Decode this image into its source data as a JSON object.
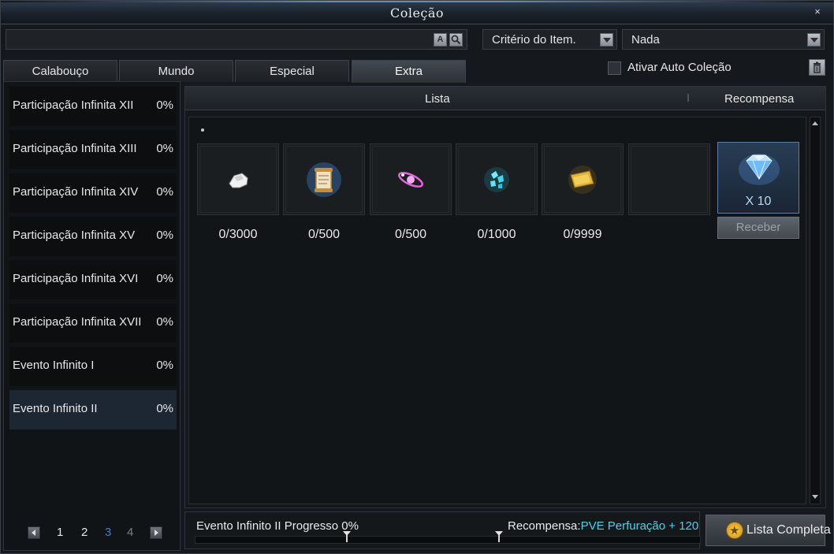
{
  "window": {
    "title": "Coleção",
    "close_symbol": "×"
  },
  "search": {
    "value": "",
    "placeholder": "",
    "btn_alpha": "A"
  },
  "filters": {
    "criteria_value": "Critério do Item.",
    "criteria2_value": "Nada"
  },
  "tabs": [
    {
      "label": "Calabouço",
      "active": false
    },
    {
      "label": "Mundo",
      "active": false
    },
    {
      "label": "Especial",
      "active": false
    },
    {
      "label": "Extra",
      "active": true
    }
  ],
  "auto_collect": {
    "label": "Ativar Auto Coleção",
    "checked": false
  },
  "categories": [
    {
      "name": "Participação Infinita XII",
      "percent": "0%"
    },
    {
      "name": "Participação Infinita XIII",
      "percent": "0%"
    },
    {
      "name": "Participação Infinita XIV",
      "percent": "0%"
    },
    {
      "name": "Participação Infinita XV",
      "percent": "0%"
    },
    {
      "name": "Participação Infinita XVI",
      "percent": "0%"
    },
    {
      "name": "Participação Infinita XVII",
      "percent": "0%"
    },
    {
      "name": "Evento Infinito I",
      "percent": "0%"
    },
    {
      "name": "Evento Infinito II",
      "percent": "0%",
      "selected": true
    }
  ],
  "pagination": {
    "pages": [
      "1",
      "2",
      "3",
      "4"
    ],
    "current": "3"
  },
  "list_header": {
    "list": "Lista",
    "reward": "Recompensa"
  },
  "items": [
    {
      "icon": "white-ore-icon",
      "count": "0/3000"
    },
    {
      "icon": "scroll-icon",
      "count": "0/500"
    },
    {
      "icon": "pink-ring-icon",
      "count": "0/500"
    },
    {
      "icon": "cyan-crystal-icon",
      "count": "0/1000"
    },
    {
      "icon": "gold-ticket-icon",
      "count": "0/9999"
    },
    {
      "icon": "empty-slot",
      "count": ""
    }
  ],
  "reward": {
    "icon": "diamond-icon",
    "quantity": "X 10",
    "receive_label": "Receber"
  },
  "footer": {
    "progress_text": "Evento Infinito II Progresso 0%",
    "progress": 0,
    "reward_label": "Recompensa:",
    "reward_value": "PVE Perfuração + 120",
    "full_list_label": "Lista Completa"
  },
  "colors": {
    "accent_blue": "#3d7ddc",
    "reward_cyan": "#4fd0e8"
  }
}
